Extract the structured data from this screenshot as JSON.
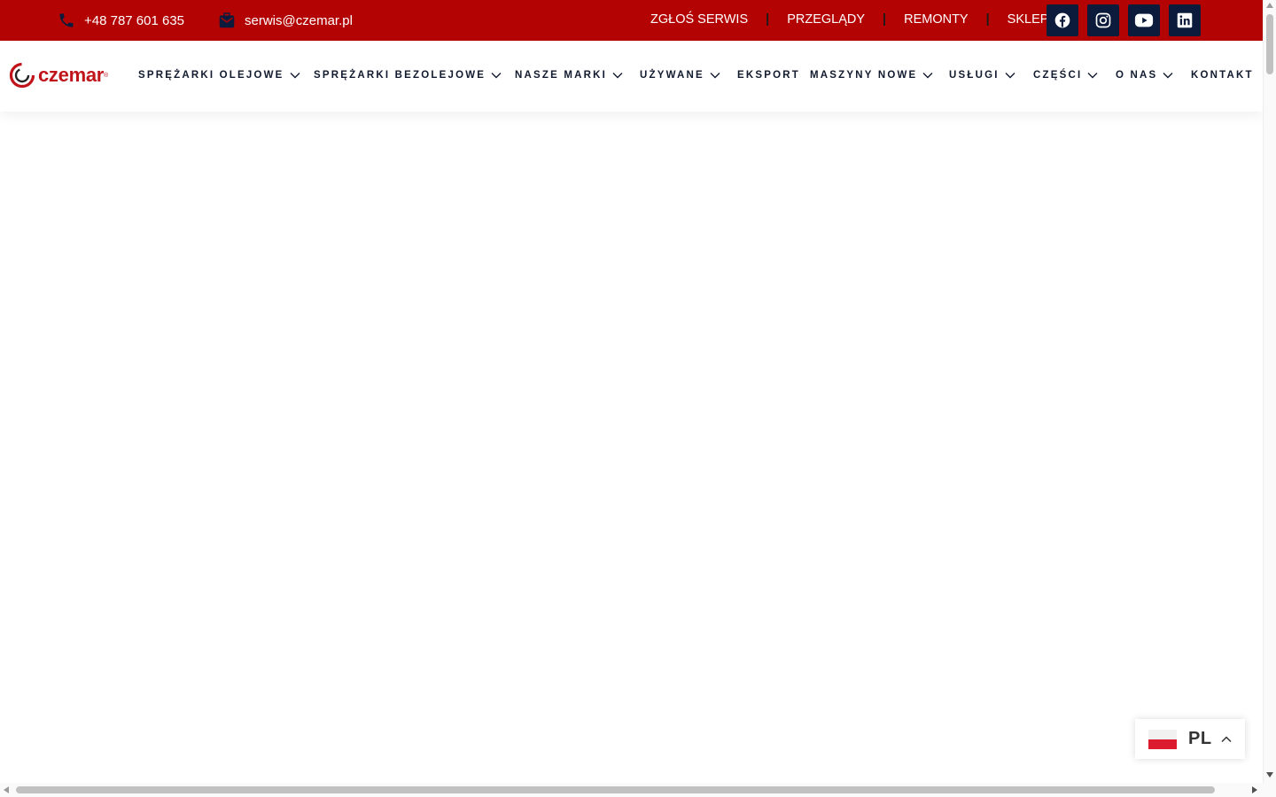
{
  "topbar": {
    "phone": "+48 787 601 635",
    "email": "serwis@czemar.pl",
    "links": [
      "ZGŁOŚ SERWIS",
      "PRZEGLĄDY",
      "REMONTY",
      "SKLEP"
    ],
    "separator": "|",
    "socials": [
      "facebook-icon",
      "instagram-icon",
      "youtube-icon",
      "linkedin-icon"
    ]
  },
  "logo": {
    "text": "czemar",
    "reg": "®"
  },
  "nav": {
    "items": [
      {
        "label": "SPRĘŻARKI OLEJOWE",
        "dropdown": true
      },
      {
        "label": "SPRĘŻARKI BEZOLEJOWE",
        "dropdown": true
      },
      {
        "label": "NASZE MARKI",
        "dropdown": true
      },
      {
        "label": "UŻYWANE",
        "dropdown": true
      },
      {
        "label": "EKSPORT",
        "dropdown": false
      },
      {
        "label": "MASZYNY NOWE",
        "dropdown": true
      },
      {
        "label": "USŁUGI",
        "dropdown": true
      },
      {
        "label": "CZĘŚCI",
        "dropdown": true
      },
      {
        "label": "O NAS",
        "dropdown": true
      },
      {
        "label": "KONTAKT",
        "dropdown": false
      }
    ]
  },
  "language": {
    "code": "PL",
    "flag": "poland-flag-icon"
  },
  "colors": {
    "topbar": "#b30303",
    "social_bg": "#0c1b3c",
    "nav_text": "#111a2e",
    "brand": "#c0141b"
  }
}
